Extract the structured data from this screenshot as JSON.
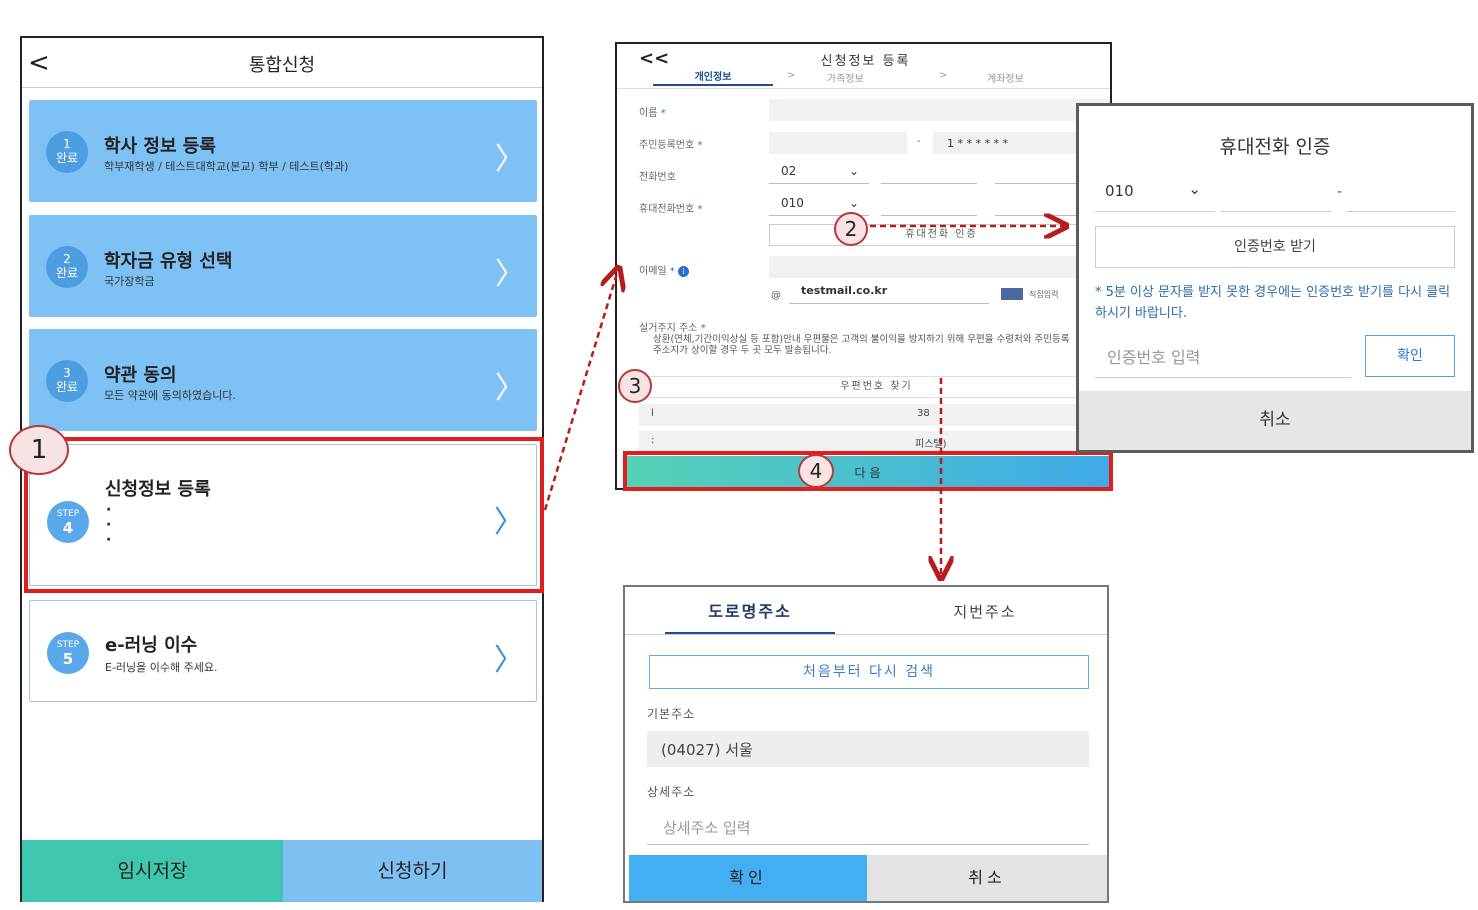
{
  "phone1": {
    "title": "통합신청",
    "back": "<",
    "cards": [
      {
        "badge_top": "1",
        "badge_bottom": "완료",
        "title": "학사 정보 등록",
        "subtitle": "학부재학생 / 테스트대학교(본교) 학부 / 테스트(학과)"
      },
      {
        "badge_top": "2",
        "badge_bottom": "완료",
        "title": "학자금 유형 선택",
        "subtitle": "국가장학금"
      },
      {
        "badge_top": "3",
        "badge_bottom": "완료",
        "title": "약관 동의",
        "subtitle": "모든 약관에 동의하였습니다."
      },
      {
        "badge_top": "STEP",
        "badge_bottom": "4",
        "title": "신청정보 등록",
        "subtitle": "·\n·\n·"
      },
      {
        "badge_top": "STEP",
        "badge_bottom": "5",
        "title": "e-러닝 이수",
        "subtitle": "E-러닝을 이수해 주세요."
      }
    ],
    "btn_save": "임시저장",
    "btn_apply": "신청하기"
  },
  "phone2": {
    "back": "<<",
    "title": "신청정보 등록",
    "tabs": [
      "개인정보",
      ">",
      "가족정보",
      ">",
      "계좌정보"
    ],
    "label_name": "이름",
    "label_rrn": "주민등록번호",
    "rrn_dash": "-",
    "rrn_back": "1 * * * * * *",
    "label_tel": "전화번호",
    "tel_prefix": "02",
    "label_mobile": "휴대전화번호",
    "mobile_prefix": "010",
    "mobile_auth_btn": "휴대전화 인증",
    "label_email": "이메일",
    "email_at": "@",
    "email_domain": "testmail.co.kr",
    "email_direct": "직접입력",
    "label_address": "실거주지 주소",
    "address_note": "상환(연체,기간이익상실 등 포함)안내 우편물은 고객의 불이익을 방지하기 위해 우편을 수령처와 주민등록주소지가 상이할 경우 두 곳 모두 발송됩니다.",
    "postcode_btn": "우편번호 찾기",
    "addr_line1_left": "l",
    "addr_line1": "38",
    "addr_line2_left": ":",
    "addr_line2": "피스텔)",
    "next_btn": "다음",
    "star": "*"
  },
  "dialog_phone": {
    "title": "휴대전화 인증",
    "prefix": "010",
    "dash": "-",
    "get_code_btn": "인증번호 받기",
    "note": "5분 이상 문자를 받지 못한 경우에는 인증번호 받기를 다시 클릭하시기 바랍니다.",
    "note_star": "*",
    "code_placeholder": "인증번호 입력",
    "confirm_btn": "확인",
    "cancel_btn": "취소"
  },
  "dialog_address": {
    "tab_road": "도로명주소",
    "tab_lot": "지번주소",
    "research_btn": "처음부터 다시 검색",
    "label_basic": "기본주소",
    "basic_value": "(04027) 서울",
    "label_detail": "상세주소",
    "detail_placeholder": "상세주소 입력",
    "confirm_btn": "확인",
    "cancel_btn": "취소"
  },
  "callouts": [
    "1",
    "2",
    "3",
    "4"
  ],
  "colors": {
    "done_card": "#7ec1f5",
    "badge": "#4c9ee0",
    "save_btn": "#3ec7ae",
    "apply_btn": "#7fc0f3",
    "highlight_red": "#e01e1e",
    "arrow": "#b71c1c",
    "next_btn_from": "#54d3b6",
    "next_btn_to": "#3fa9e8"
  }
}
